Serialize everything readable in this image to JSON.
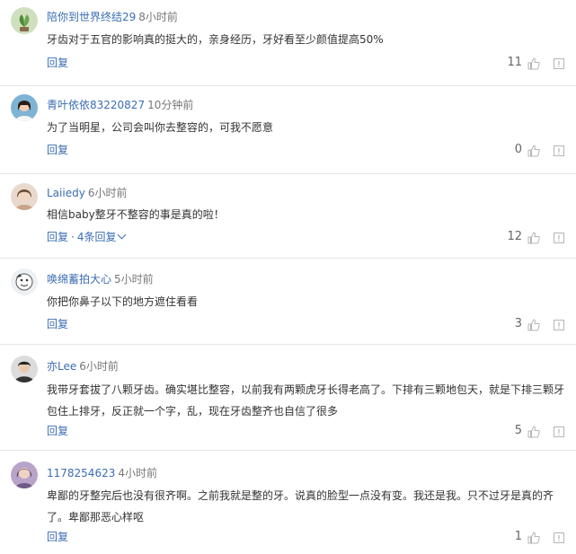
{
  "comments": [
    {
      "username": "陪你到世界终结29",
      "time": "8小时前",
      "text": "牙齿对于五官的影响真的挺大的，亲身经历，牙好看至少颜值提高50%",
      "reply_label": "回复",
      "replies_label": "",
      "likes": "11",
      "avatar": "green-plant-avatar"
    },
    {
      "username": "青叶依依83220827",
      "time": "10分钟前",
      "text": "为了当明星，公司会叫你去整容的，可我不愿意",
      "reply_label": "回复",
      "replies_label": "",
      "likes": "0",
      "avatar": "girl-portrait-avatar"
    },
    {
      "username": "Laiiedy",
      "time": "6小时前",
      "text": "相信baby整牙不整容的事是真的啦！",
      "reply_label": "回复",
      "replies_label": "4条回复",
      "likes": "12",
      "avatar": "woman-portrait-avatar"
    },
    {
      "username": "唤绵蓄拍大心",
      "time": "5小时前",
      "text": "你把你鼻子以下的地方遮住看看",
      "reply_label": "回复",
      "replies_label": "",
      "likes": "3",
      "avatar": "cartoon-avatar"
    },
    {
      "username": "亦Lee",
      "time": "6小时前",
      "text": "我带牙套拔了八颗牙齿。确实堪比整容，以前我有两颗虎牙长得老高了。下排有三颗地包天，就是下排三颗牙包住上排牙，反正就一个字，乱，现在牙齿整齐也自信了很多",
      "reply_label": "回复",
      "replies_label": "",
      "likes": "5",
      "avatar": "man-portrait-avatar"
    },
    {
      "username": "1178254623",
      "time": "4小时前",
      "text": "卑鄙的牙整完后也没有很齐啊。之前我就是整的牙。说真的脸型一点没有变。我还是我。只不过牙是真的齐了。卑鄙那恶心样呕",
      "reply_label": "回复",
      "replies_label": "",
      "likes": "1",
      "avatar": "purple-portrait-avatar"
    }
  ],
  "reply_separator": "·",
  "colors": {
    "link": "#3b6db4",
    "text": "#333333",
    "muted": "#777777",
    "divider": "#e6e6e6",
    "icon": "#b5b5b5"
  }
}
